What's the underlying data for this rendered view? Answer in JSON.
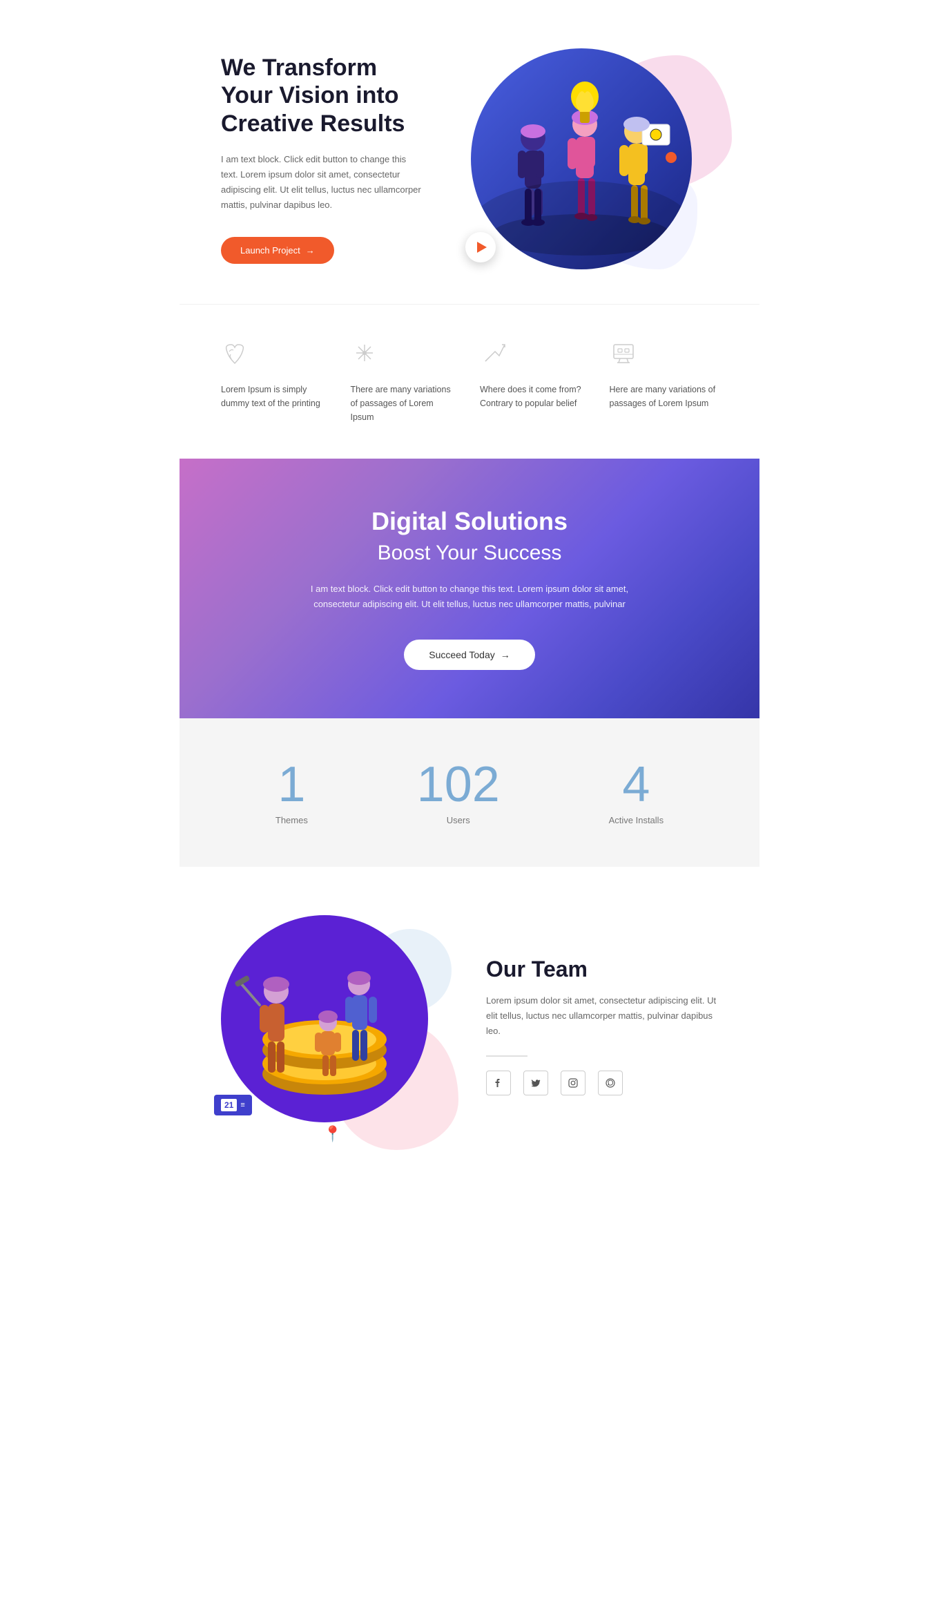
{
  "hero": {
    "title": "We Transform Your Vision into Creative Results",
    "description": "I am text block. Click edit button to change this text. Lorem ipsum dolor sit amet, consectetur adipiscing elit. Ut elit tellus, luctus nec ullamcorper mattis, pulvinar dapibus leo.",
    "launch_btn": "Launch Project",
    "launch_arrow": "→"
  },
  "features": [
    {
      "icon": "🌿",
      "text": "Lorem Ipsum is simply dummy text of the printing"
    },
    {
      "icon": "❄",
      "text": "There are many variations of passages of Lorem Ipsum"
    },
    {
      "icon": "✈",
      "text": "Where does it come from? Contrary to popular belief"
    },
    {
      "icon": "🖥",
      "text": "Here are many variations of passages of Lorem Ipsum"
    }
  ],
  "digital": {
    "title": "Digital Solutions",
    "subtitle": "Boost Your Success",
    "description": "I am text block. Click edit button to change this text. Lorem ipsum dolor sit amet, consectetur adipiscing elit. Ut elit tellus, luctus nec ullamcorper mattis, pulvinar",
    "btn_label": "Succeed Today",
    "btn_arrow": "→"
  },
  "stats": [
    {
      "number": "1",
      "label": "Themes"
    },
    {
      "number": "102",
      "label": "Users"
    },
    {
      "number": "4",
      "label": "Active Installs"
    }
  ],
  "team": {
    "title": "Our Team",
    "description": "Lorem ipsum dolor sit amet, consectetur adipiscing elit. Ut elit tellus, luctus nec ullamcorper mattis, pulvinar dapibus leo.",
    "badge_num": "21",
    "social": [
      {
        "name": "facebook",
        "icon": "f"
      },
      {
        "name": "twitter",
        "icon": "t"
      },
      {
        "name": "instagram",
        "icon": "i"
      },
      {
        "name": "whatsapp",
        "icon": "w"
      }
    ]
  }
}
